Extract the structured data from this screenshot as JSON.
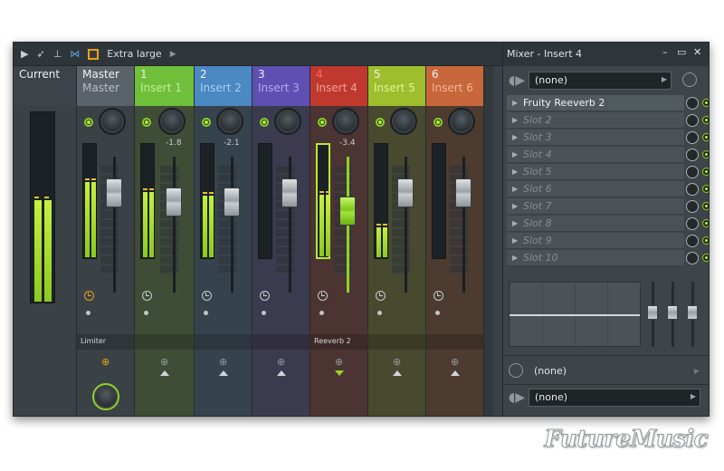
{
  "toolbar": {
    "view_label": "Extra large"
  },
  "strips": [
    {
      "id": "current",
      "num": "Current",
      "name": "",
      "color": "#3c4449",
      "textColor": "#d8dde0"
    },
    {
      "id": "master",
      "num": "Master",
      "name": "Master",
      "color": "#5a6369",
      "textColor": "#b6bdc2",
      "slotLabel": "Limiter",
      "routeIcon": "orange"
    },
    {
      "id": "i1",
      "num": "1",
      "name": "Insert 1",
      "color": "#6fbf3b",
      "textColor": "#c6eb9a",
      "body": "#3f4d36",
      "db": "-1.8"
    },
    {
      "id": "i2",
      "num": "2",
      "name": "Insert 2",
      "color": "#4a89c2",
      "textColor": "#a9cdef",
      "body": "#36434d",
      "db": "-2.1"
    },
    {
      "id": "i3",
      "num": "3",
      "name": "Insert 3",
      "color": "#5f4fb3",
      "textColor": "#b3a8ef",
      "body": "#3c3a4e"
    },
    {
      "id": "i4",
      "num": "4",
      "name": "Insert 4",
      "color": "#c0392f",
      "textColor": "#f2a19a",
      "body": "#4b3431",
      "db": "-3.4",
      "slotLabel": "Reeverb 2"
    },
    {
      "id": "i5",
      "num": "5",
      "name": "Insert 5",
      "color": "#9fbe2e",
      "textColor": "#e2f29e",
      "body": "#48492f"
    },
    {
      "id": "i6",
      "num": "6",
      "name": "Insert 6",
      "color": "#c8673c",
      "textColor": "#f3b594",
      "body": "#4d3b30"
    }
  ],
  "panel": {
    "title": "Mixer - Insert 4",
    "input_select": "(none)",
    "slots": [
      {
        "label": "Fruity Reeverb 2",
        "active": true
      },
      {
        "label": "Slot 2"
      },
      {
        "label": "Slot 3"
      },
      {
        "label": "Slot 4"
      },
      {
        "label": "Slot 5"
      },
      {
        "label": "Slot 6"
      },
      {
        "label": "Slot 7"
      },
      {
        "label": "Slot 8"
      },
      {
        "label": "Slot 9"
      },
      {
        "label": "Slot 10"
      }
    ],
    "latency_label": "(none)",
    "output_select": "(none)"
  },
  "watermark": "FutureMusic"
}
